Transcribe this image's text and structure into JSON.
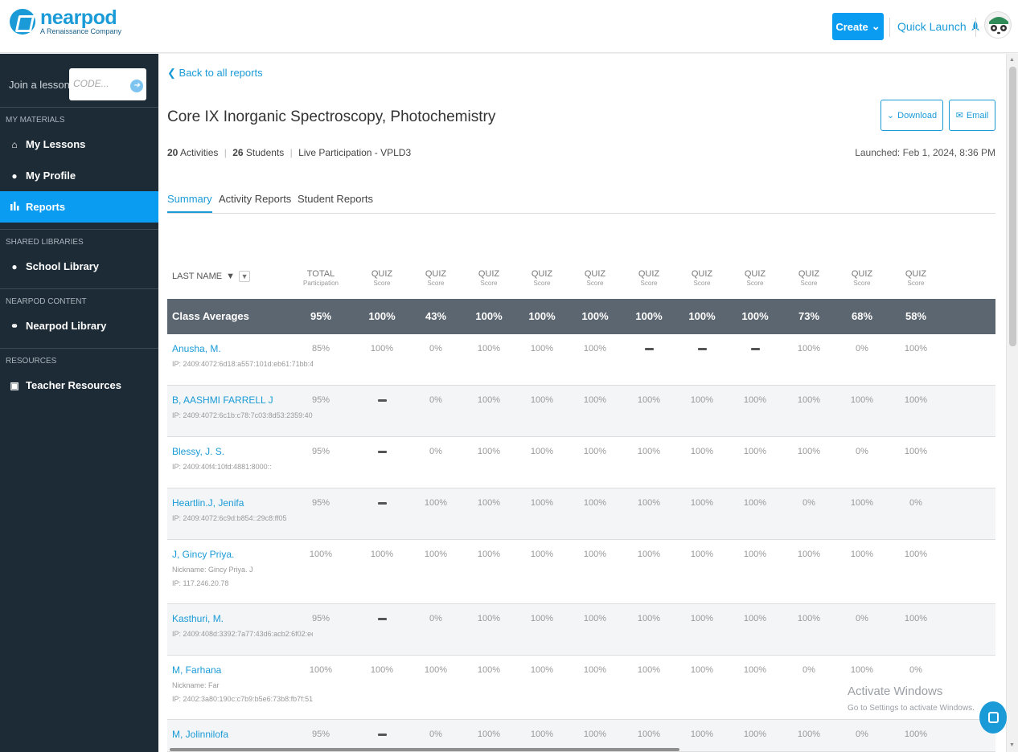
{
  "brand": {
    "name": "nearpod",
    "tagline": "A Renaissance Company",
    "color": "#1a9bd7"
  },
  "topbar": {
    "create_label": "Create",
    "quick_launch_label": "Quick Launch"
  },
  "sidebar": {
    "join_label": "Join a lesson",
    "join_placeholder": "CODE...",
    "sections": [
      {
        "heading": "MY MATERIALS",
        "items": [
          {
            "label": "My Lessons",
            "icon": "home-icon"
          },
          {
            "label": "My Profile",
            "icon": "person-icon"
          },
          {
            "label": "Reports",
            "icon": "bar-chart-icon",
            "active": true
          }
        ]
      },
      {
        "heading": "SHARED LIBRARIES",
        "items": [
          {
            "label": "School Library",
            "icon": "users-icon"
          }
        ]
      },
      {
        "heading": "NEARPOD CONTENT",
        "items": [
          {
            "label": "Nearpod Library",
            "icon": "compass-icon"
          }
        ]
      },
      {
        "heading": "RESOURCES",
        "items": [
          {
            "label": "Teacher Resources",
            "icon": "book-icon"
          }
        ]
      }
    ]
  },
  "report": {
    "back_label": "Back to all reports",
    "title": "Core IX Inorganic Spectroscopy, Photochemistry",
    "activities_count": "20",
    "activities_label": "Activities",
    "students_count": "26",
    "students_label": "Students",
    "mode": "Live Participation - VPLD3",
    "launched": "Launched: Feb 1, 2024, 8:36 PM",
    "download_label": "Download",
    "email_label": "Email",
    "tabs": [
      "Summary",
      "Activity Reports",
      "Student Reports"
    ],
    "active_tab": "Summary"
  },
  "table": {
    "name_header": "LAST NAME",
    "columns": [
      {
        "top": "TOTAL",
        "sub": "Participation"
      },
      {
        "top": "QUIZ",
        "sub": "Score"
      },
      {
        "top": "QUIZ",
        "sub": "Score"
      },
      {
        "top": "QUIZ",
        "sub": "Score"
      },
      {
        "top": "QUIZ",
        "sub": "Score"
      },
      {
        "top": "QUIZ",
        "sub": "Score"
      },
      {
        "top": "QUIZ",
        "sub": "Score"
      },
      {
        "top": "QUIZ",
        "sub": "Score"
      },
      {
        "top": "QUIZ",
        "sub": "Score"
      },
      {
        "top": "QUIZ",
        "sub": "Score"
      },
      {
        "top": "QUIZ",
        "sub": "Score"
      },
      {
        "top": "QUIZ",
        "sub": "Score"
      }
    ],
    "averages_label": "Class Averages",
    "averages": [
      "95%",
      "100%",
      "43%",
      "100%",
      "100%",
      "100%",
      "100%",
      "100%",
      "100%",
      "73%",
      "68%",
      "58%"
    ],
    "rows": [
      {
        "name": "Anusha, M.",
        "lines": [
          "IP: 2409:4072:6d18:a557:101d:eb61:71bb:4"
        ],
        "values": [
          "85%",
          "100%",
          "0%",
          "100%",
          "100%",
          "100%",
          "-",
          "-",
          "-",
          "100%",
          "0%",
          "100%"
        ]
      },
      {
        "name": "B, AASHMI FARRELL J",
        "lines": [
          "IP: 2409:4072:6c1b:c78:7c03:8d53:2359:40"
        ],
        "values": [
          "95%",
          "-",
          "0%",
          "100%",
          "100%",
          "100%",
          "100%",
          "100%",
          "100%",
          "100%",
          "100%",
          "100%"
        ]
      },
      {
        "name": "Blessy, J. S.",
        "lines": [
          "IP: 2409:40f4:10fd:4881:8000::"
        ],
        "values": [
          "95%",
          "-",
          "0%",
          "100%",
          "100%",
          "100%",
          "100%",
          "100%",
          "100%",
          "100%",
          "0%",
          "100%"
        ]
      },
      {
        "name": "Heartlin.J, Jenifa",
        "lines": [
          "IP: 2409:4072:6c9d:b854::29c8:ff05"
        ],
        "values": [
          "95%",
          "-",
          "100%",
          "100%",
          "100%",
          "100%",
          "100%",
          "100%",
          "100%",
          "0%",
          "100%",
          "0%"
        ]
      },
      {
        "name": "J, Gincy Priya.",
        "lines": [
          "Nickname: Gincy Priya. J",
          "IP: 117.246.20.78"
        ],
        "values": [
          "100%",
          "100%",
          "100%",
          "100%",
          "100%",
          "100%",
          "100%",
          "100%",
          "100%",
          "100%",
          "100%",
          "100%"
        ]
      },
      {
        "name": "Kasthuri, M.",
        "lines": [
          "IP: 2409:408d:3392:7a77:43d6:acb2:6f02:ee"
        ],
        "values": [
          "95%",
          "-",
          "0%",
          "100%",
          "100%",
          "100%",
          "100%",
          "100%",
          "100%",
          "100%",
          "0%",
          "100%"
        ]
      },
      {
        "name": "M, Farhana",
        "lines": [
          "Nickname: Far",
          "IP: 2402:3a80:190c:c7b9:b5e6:73b8:fb7f:51"
        ],
        "values": [
          "100%",
          "100%",
          "100%",
          "100%",
          "100%",
          "100%",
          "100%",
          "100%",
          "100%",
          "0%",
          "100%",
          "0%"
        ]
      },
      {
        "name": "M, Jolinnilofa",
        "lines": [],
        "values": [
          "95%",
          "-",
          "0%",
          "100%",
          "100%",
          "100%",
          "100%",
          "100%",
          "100%",
          "100%",
          "0%",
          "100%"
        ]
      }
    ]
  },
  "watermark": {
    "title": "Activate Windows",
    "subtitle": "Go to Settings to activate Windows."
  }
}
